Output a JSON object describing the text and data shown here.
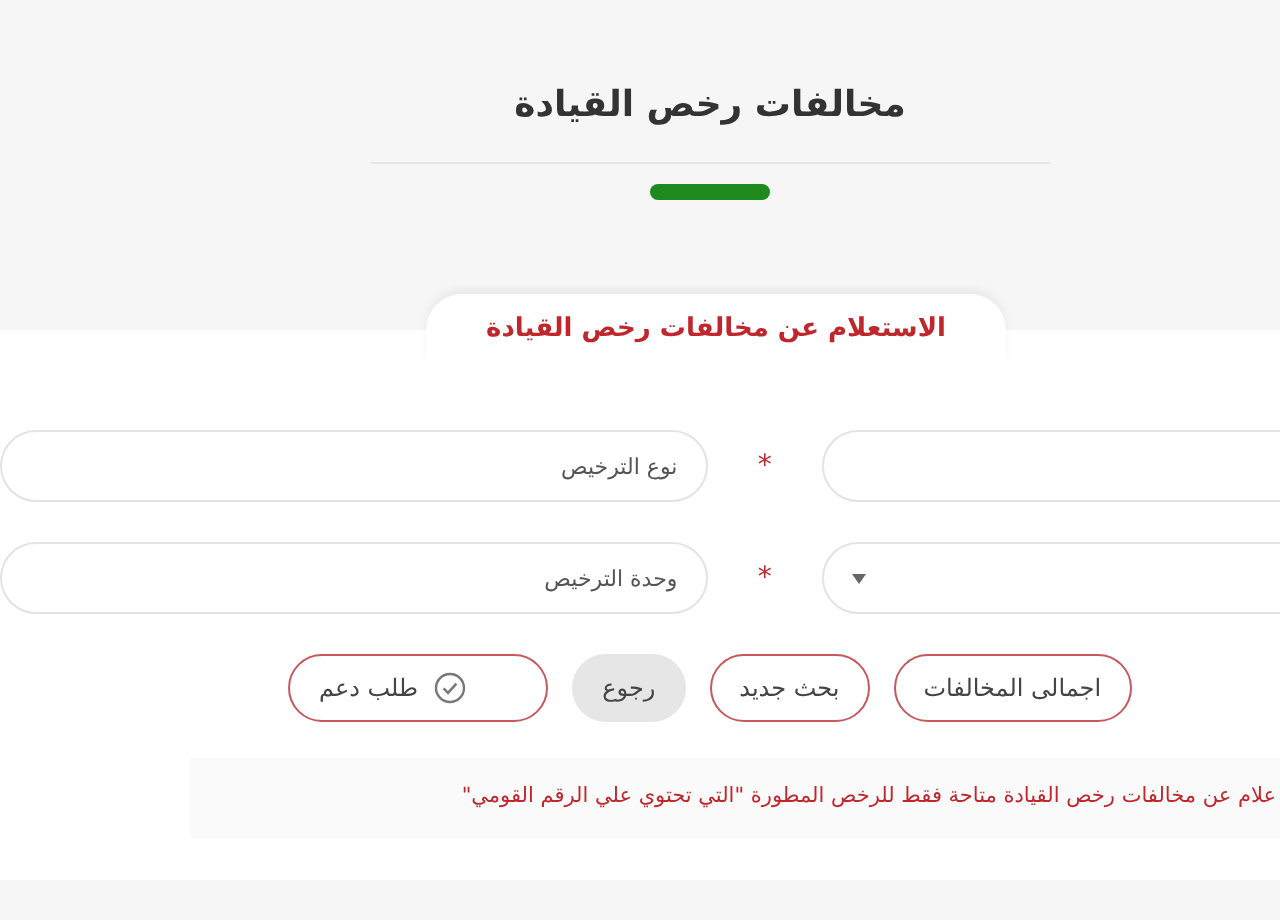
{
  "page_title": "مخالفات رخص القيادة",
  "form": {
    "tab_title": "الاستعلام عن مخالفات رخص القيادة",
    "rows": [
      {
        "field": {
          "kind": "input"
        },
        "required_mark": "*",
        "option": {
          "placeholder": "نوع الترخيص"
        }
      },
      {
        "field": {
          "kind": "select"
        },
        "required_mark": "*",
        "option": {
          "placeholder": "وحدة الترخيص"
        }
      }
    ],
    "buttons": [
      {
        "label": "اجمالى المخالفات",
        "kind": "outline"
      },
      {
        "label": "بحث جديد",
        "kind": "outline"
      },
      {
        "label": "رجوع",
        "kind": "grey"
      },
      {
        "label": "طلب دعم",
        "kind": "outline-check"
      }
    ],
    "notice": "علام عن مخالفات رخص القيادة متاحة فقط للرخص المطورة \"التي تحتوي علي الرقم القومي\""
  }
}
